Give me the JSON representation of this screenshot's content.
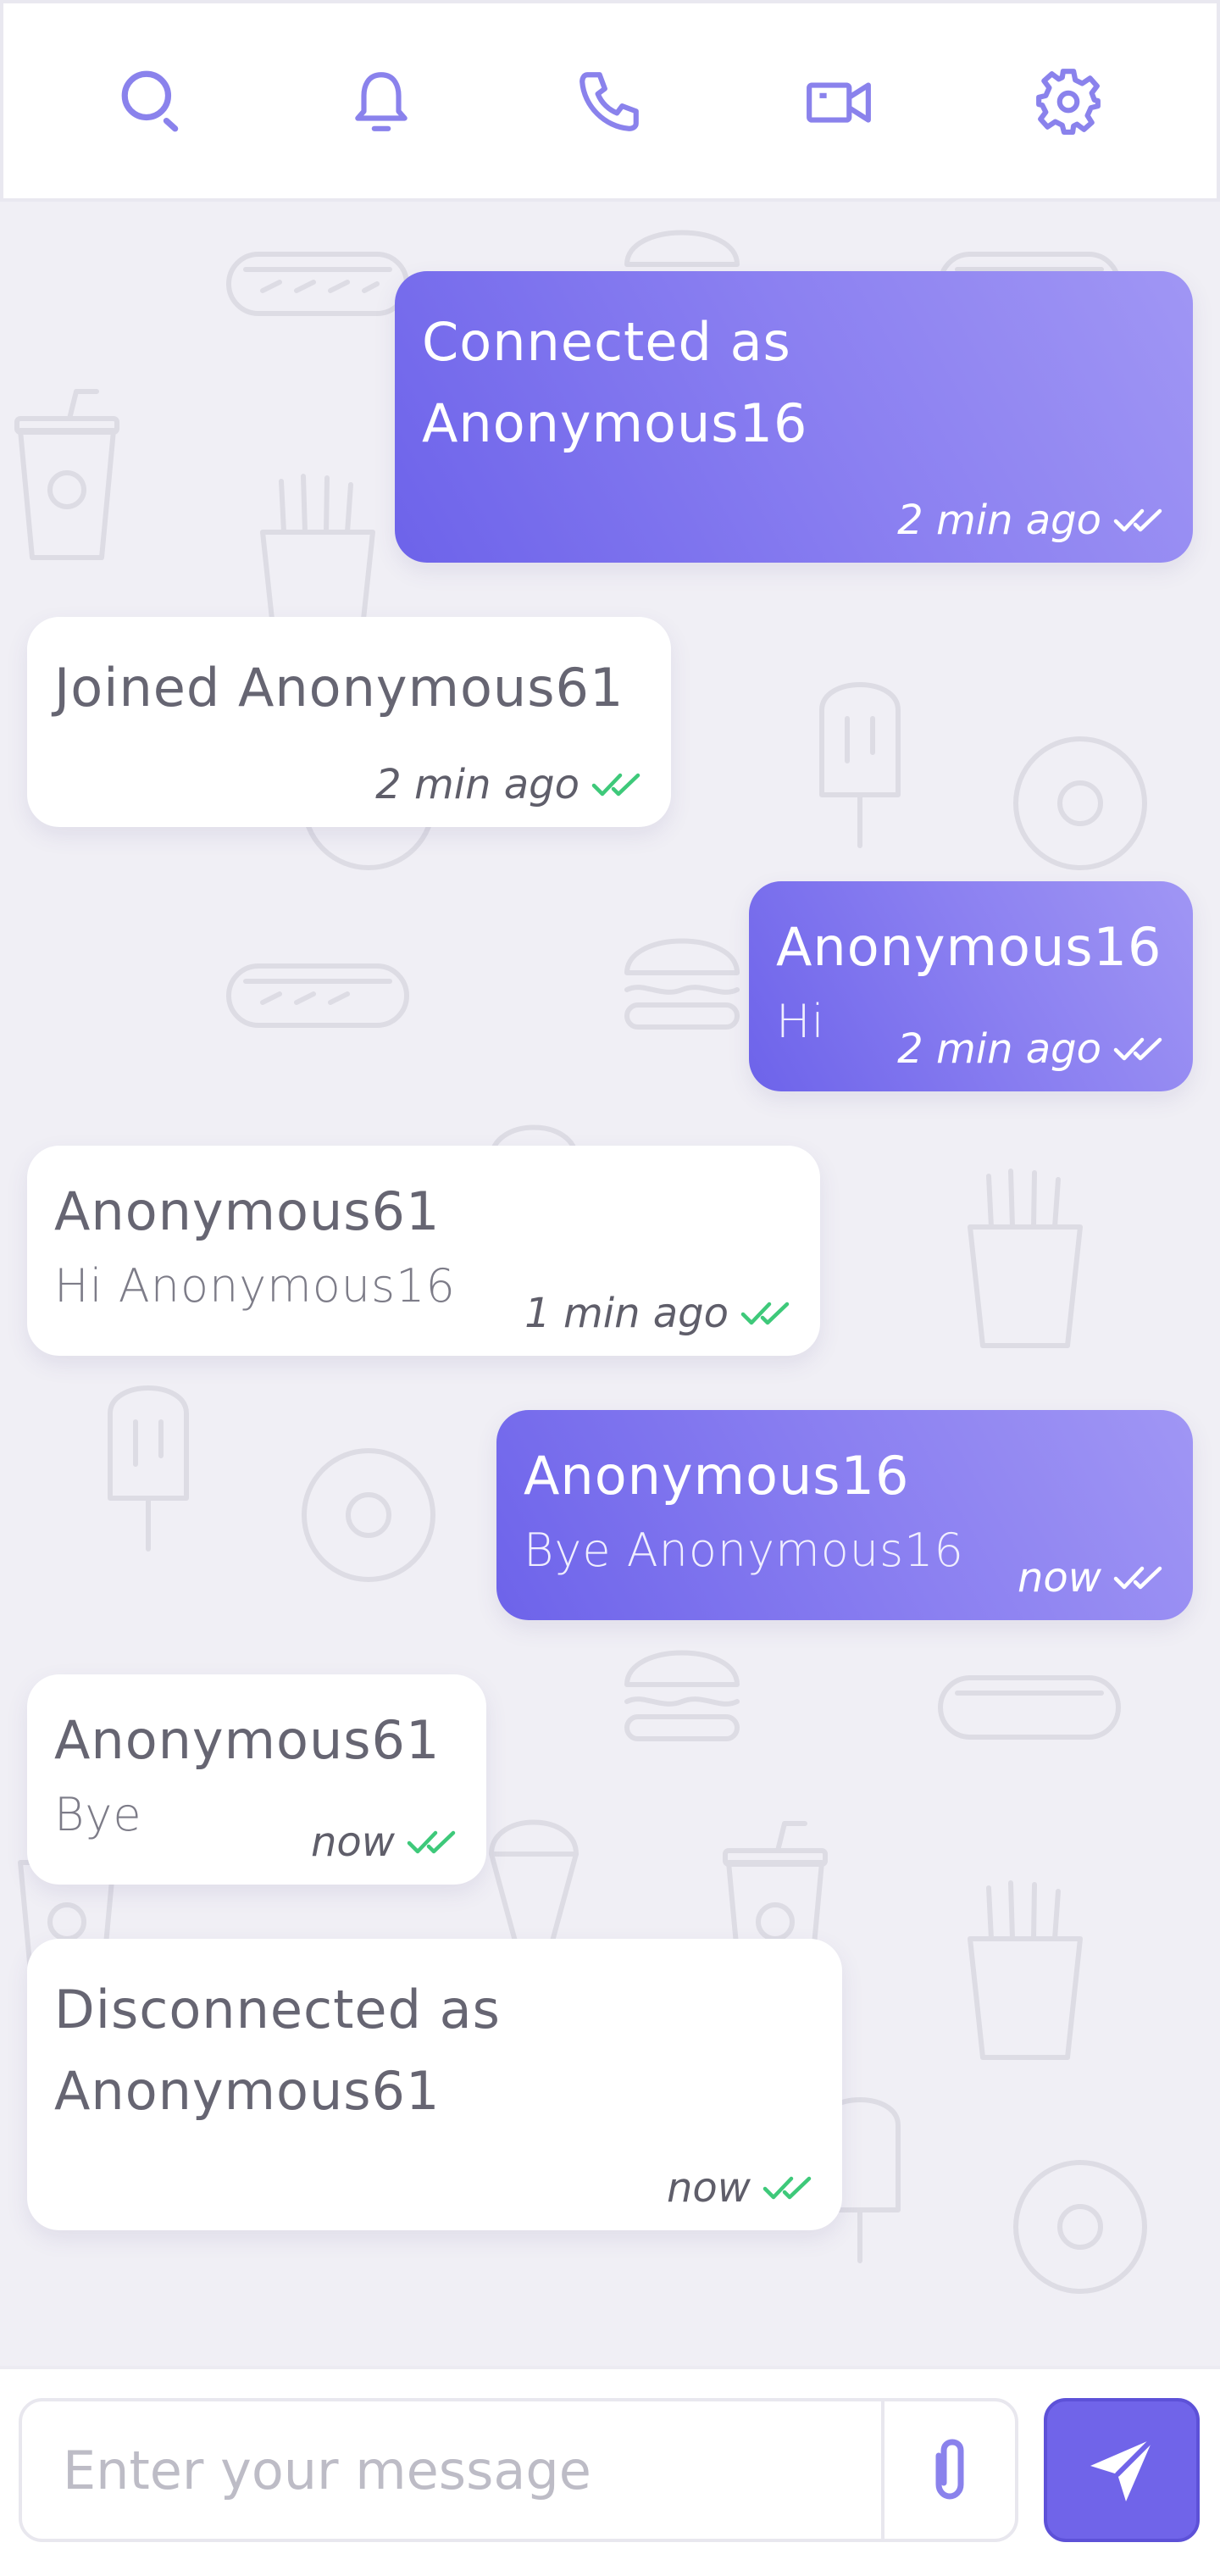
{
  "toolbar": {
    "icons": [
      "search-icon",
      "bell-icon",
      "phone-icon",
      "video-camera-icon",
      "gear-icon"
    ],
    "accent": "#8a82ec"
  },
  "colors": {
    "outgoing_bubble": "#7064e9",
    "incoming_bubble": "#ffffff",
    "read_check_incoming": "#3ec97a",
    "background": "#f0eff5"
  },
  "messages": [
    {
      "direction": "out",
      "text": "Connected as Anonymous16",
      "time": "2 min ago"
    },
    {
      "direction": "in",
      "text": "Joined Anonymous61",
      "time": "2 min ago"
    },
    {
      "direction": "out",
      "sender": "Anonymous16",
      "text": "Hi",
      "time": "2 min ago"
    },
    {
      "direction": "in",
      "sender": "Anonymous61",
      "text": "Hi Anonymous16",
      "time": "1 min ago"
    },
    {
      "direction": "out",
      "sender": "Anonymous16",
      "text": "Bye Anonymous16",
      "time": "now"
    },
    {
      "direction": "in",
      "sender": "Anonymous61",
      "text": "Bye",
      "time": "now"
    },
    {
      "direction": "in",
      "text": "Disconnected as Anonymous61",
      "time": "now"
    }
  ],
  "composer": {
    "placeholder": "Enter your message",
    "value": ""
  }
}
